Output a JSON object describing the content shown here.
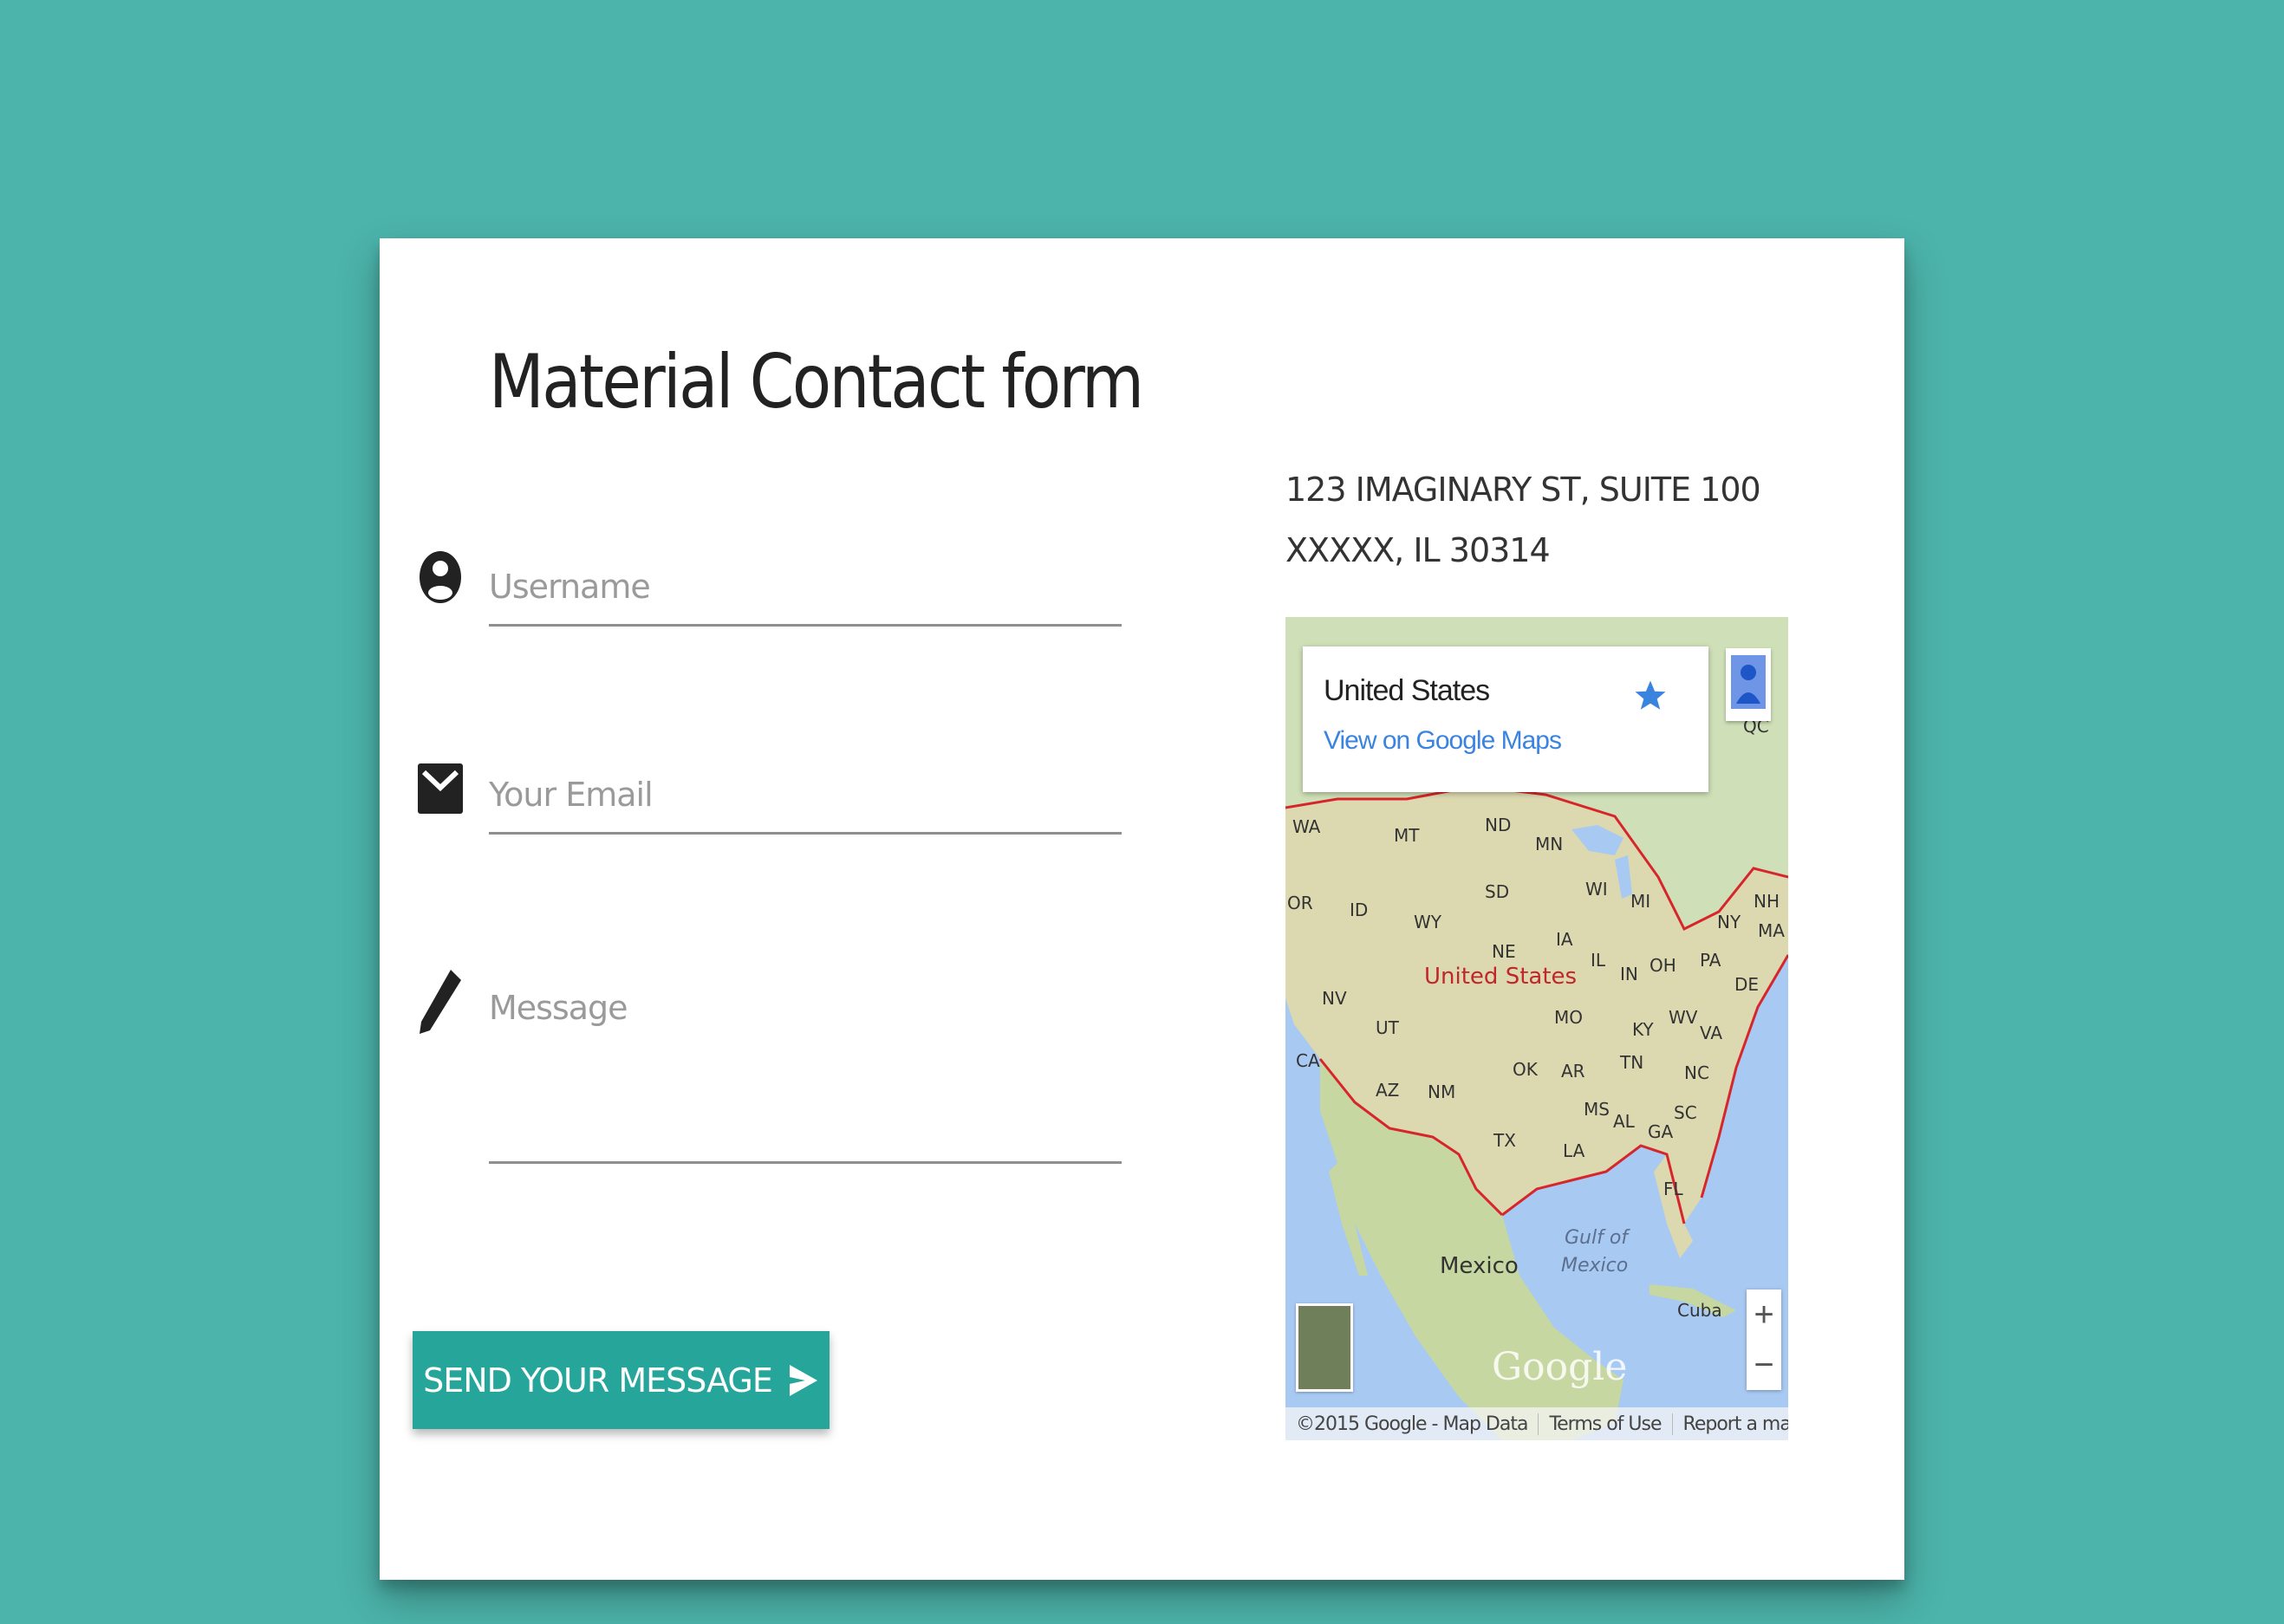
{
  "form": {
    "title": "Material Contact form",
    "username_placeholder": "Username",
    "email_placeholder": "Your Email",
    "message_placeholder": "Message",
    "send_label": "SEND YOUR MESSAGE"
  },
  "address": {
    "line1": "123 IMAGINARY ST, SUITE 100",
    "line2": "XXXXX, IL 30314"
  },
  "map": {
    "place_name": "United States",
    "view_link": "View on Google Maps",
    "country_label": "United States",
    "mexico_label": "Mexico",
    "gulf_label_1": "Gulf of",
    "gulf_label_2": "Mexico",
    "cuba_label": "Cuba",
    "logo_text": "Google",
    "zoom_in": "+",
    "zoom_out": "−",
    "state_labels": [
      "WA",
      "MT",
      "ND",
      "MN",
      "OR",
      "ID",
      "SD",
      "WI",
      "MI",
      "NY",
      "NH",
      "MA",
      "WY",
      "NE",
      "IA",
      "PA",
      "NV",
      "UT",
      "IL",
      "IN",
      "OH",
      "DE",
      "CA",
      "MO",
      "KY",
      "WV",
      "VA",
      "OK",
      "AR",
      "TN",
      "NC",
      "AZ",
      "NM",
      "MS",
      "AL",
      "GA",
      "SC",
      "TX",
      "LA",
      "FL",
      "QC"
    ],
    "attribution": {
      "copyright": "©2015 Google - Map Data",
      "terms": "Terms of Use",
      "report": "Report a map error"
    }
  },
  "colors": {
    "background": "#4cb4ab",
    "button": "#26a59a",
    "link": "#3a84df",
    "border_line": "#d7262b"
  },
  "icons": {
    "user": "account-circle-icon",
    "email": "mail-icon",
    "message": "pencil-icon",
    "send": "send-arrow-icon",
    "star": "star-icon",
    "pegman": "pegman-icon"
  }
}
